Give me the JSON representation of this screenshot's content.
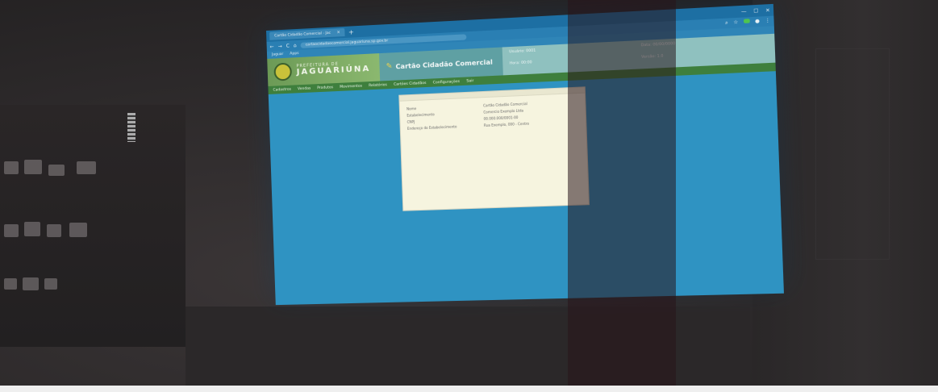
{
  "browser": {
    "tab_title": "Cartão Cidadão Comercial - Jac",
    "tab_close": "×",
    "new_tab": "+",
    "address": "cartaocidadaocomercial.jaguariuna.sp.gov.br",
    "nav_back": "←",
    "nav_forward": "→",
    "nav_reload": "C",
    "nav_home": "⌂",
    "window_minimize": "—",
    "window_maximize": "☐",
    "window_close": "✕",
    "bookmarks": [
      "Jaguar",
      "Apps"
    ]
  },
  "site": {
    "brand_small": "PREFEITURA DE",
    "brand_big": "JAGUARIÚNA",
    "title": "Cartão Cidadão Comercial",
    "info": [
      "Usuário: 0001",
      "Data: 00/00/0000",
      "Hora: 00:00",
      "Versão: 1.0"
    ],
    "nav": [
      "Cadastros",
      "Vendas",
      "Produtos",
      "Movimentos",
      "Relatórios",
      "Cartões Cidadãos",
      "Configurações",
      "Sair"
    ]
  },
  "modal": {
    "rows": [
      {
        "label": "Nome",
        "value": "Cartão Cidadão Comercial"
      },
      {
        "label": "Estabelecimento",
        "value": "Comercio Exemplo Ltda"
      },
      {
        "label": "CNPJ",
        "value": "00.000.000/0001-00"
      },
      {
        "label": "Endereço do Estabelecimento",
        "value": "Rua Exemplo, 000 - Centro"
      }
    ]
  },
  "colors": {
    "screen_blue": "#2f93c2",
    "header_green": "#6c9a56",
    "nav_green": "#3e7f3d",
    "modal_bg": "#f6f4df"
  }
}
